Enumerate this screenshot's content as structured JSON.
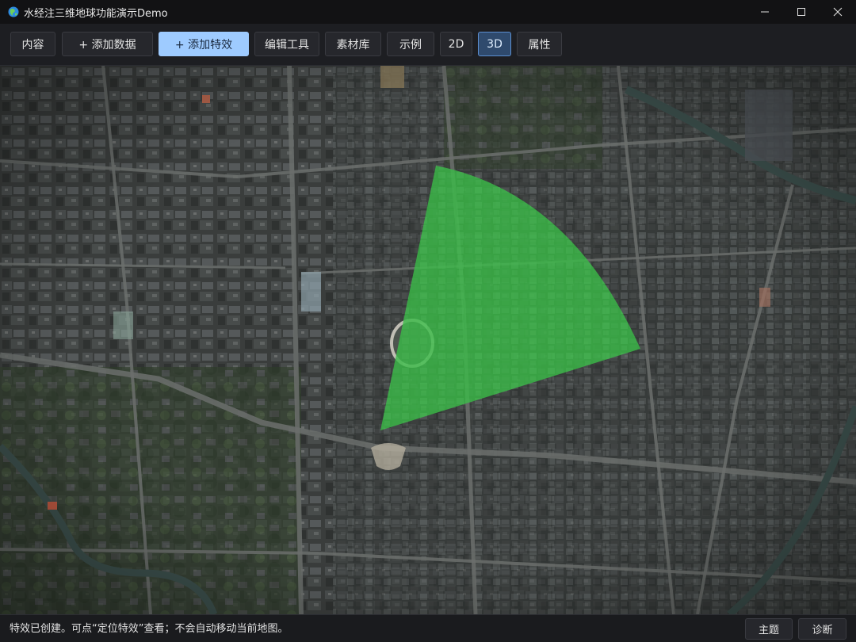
{
  "window": {
    "title": "水经注三维地球功能演示Demo",
    "controls": [
      "minimize-icon",
      "maximize-icon",
      "close-icon"
    ]
  },
  "toolbar": {
    "content_label": "内容",
    "add_data_label": "+ 添加数据",
    "add_effect_label": "+ 添加特效",
    "edit_tools_label": "编辑工具",
    "assets_label": "素材库",
    "examples_label": "示例",
    "mode_2d_label": "2D",
    "mode_3d_label": "3D",
    "properties_label": "属性",
    "active_mode": "3D"
  },
  "map": {
    "effect_shape": "sector",
    "effect_color": "#3bd14a",
    "imagery": "satellite"
  },
  "status": {
    "message": "特效已创建。可点“定位特效”查看；不会自动移动当前地图。",
    "theme_label": "主题",
    "diagnose_label": "诊断"
  },
  "colors": {
    "primary_button": "#9ecbff",
    "active_button_border": "#5b8fd1",
    "effect_fill": "#3bd14a"
  }
}
